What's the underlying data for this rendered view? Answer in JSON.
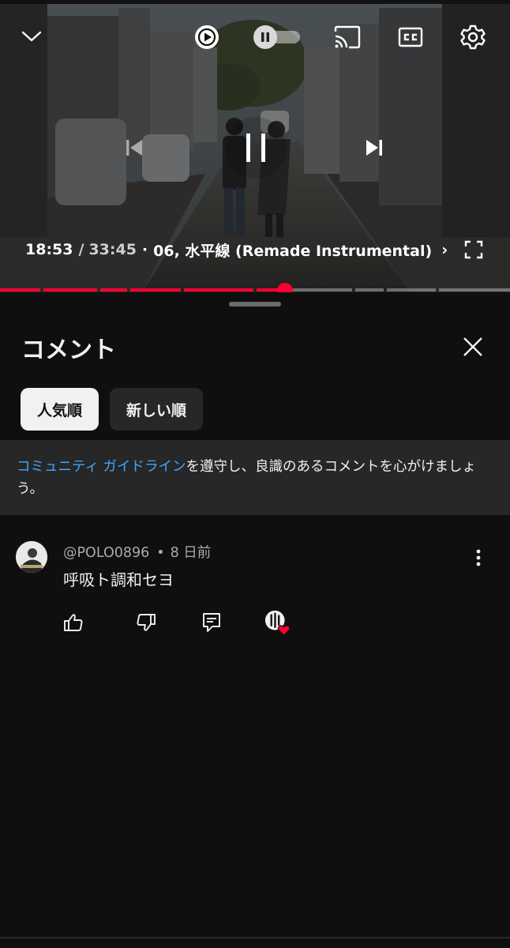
{
  "player": {
    "current_time": "18:53",
    "time_separator": "/",
    "duration": "33:45",
    "chapter_separator": "·",
    "chapter_title": "06, 水平線 (Remade Instrumental)",
    "chapter_chevron": "›",
    "progress_fraction": 0.56,
    "accent_color": "#ff0033",
    "icons": [
      "chevron-down-icon",
      "autoplay-icon",
      "pause-toggle-icon",
      "cast-icon",
      "captions-icon",
      "settings-icon",
      "previous-icon",
      "pause-icon",
      "next-icon",
      "fullscreen-icon"
    ]
  },
  "panel": {
    "title": "コメント",
    "chips": [
      {
        "label": "人気順",
        "selected": true
      },
      {
        "label": "新しい順",
        "selected": false
      }
    ],
    "guidelines": {
      "link_text": "コミュニティ ガイドライン",
      "rest_text": "を遵守し、良識のあるコメントを心がけましょう。",
      "link_color": "#3ea6ff"
    }
  },
  "comments": [
    {
      "author": "@POLO0896",
      "separator": "•",
      "age": "8 日前",
      "text": "呼吸ト調和セヨ",
      "actions": [
        "like-icon",
        "dislike-icon",
        "reply-icon",
        "creator-heart-icon"
      ]
    }
  ]
}
